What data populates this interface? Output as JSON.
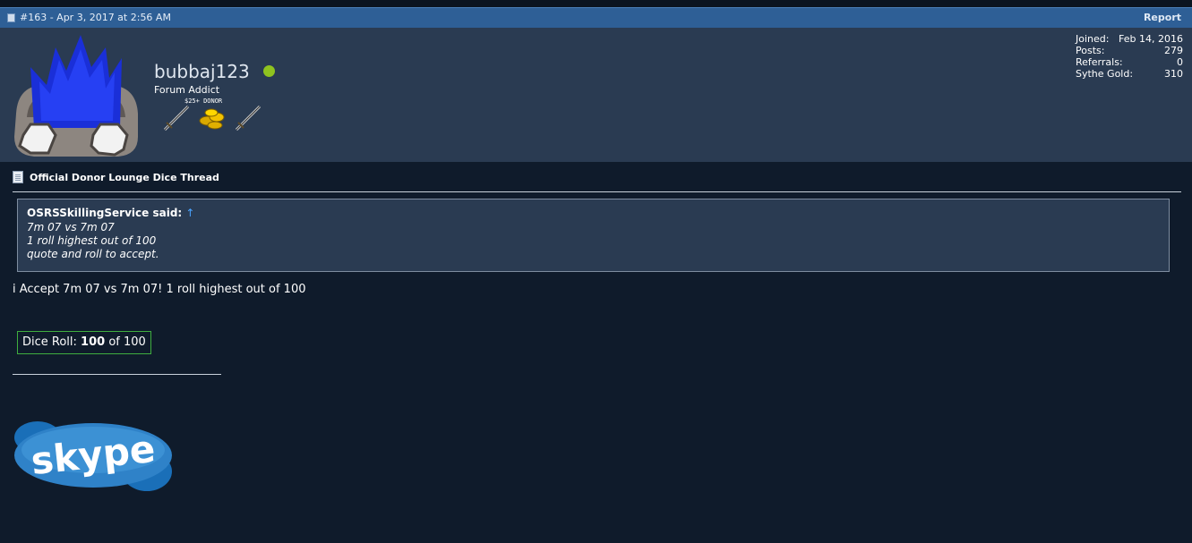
{
  "post": {
    "meta": "#163 - Apr 3, 2017 at 2:56 AM",
    "report_label": "Report"
  },
  "user": {
    "name": "bubbaj123",
    "title": "Forum Addict",
    "badge_label": "$25+ DONOR",
    "status_color": "#8fc31f",
    "stats": [
      {
        "label": "Joined:",
        "value": "Feb 14, 2016"
      },
      {
        "label": "Posts:",
        "value": "279"
      },
      {
        "label": "Referrals:",
        "value": "0"
      },
      {
        "label": "Sythe Gold:",
        "value": "310"
      }
    ]
  },
  "thread": {
    "title": "Official Donor Lounge Dice Thread"
  },
  "quote": {
    "author": "OSRSSkillingService said:",
    "arrow": "↑",
    "lines": [
      "7m 07 vs 7m 07",
      "1 roll highest out of 100",
      "quote and roll to accept."
    ]
  },
  "reply": {
    "text": "i Accept 7m 07 vs 7m 07! 1 roll highest out of 100"
  },
  "dice": {
    "label": "Dice Roll:",
    "value": "100",
    "of_text": "of 100"
  },
  "signature": {
    "logo_text": "skype"
  },
  "colors": {
    "header_bg": "#2e5f96",
    "userbar_bg": "#2a3b52",
    "content_bg": "#0f1b2b",
    "dice_border": "#3fae3f",
    "quote_arrow": "#4aa3ff"
  }
}
